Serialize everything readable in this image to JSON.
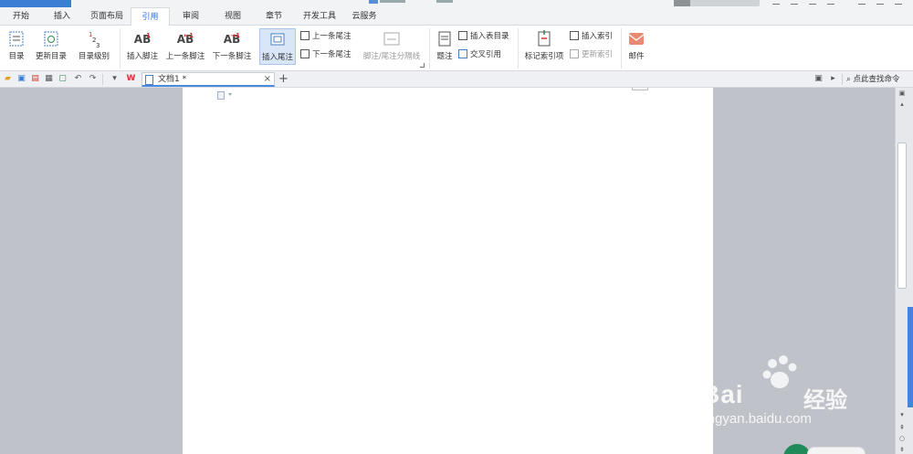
{
  "tabs": [
    "开始",
    "插入",
    "页面布局",
    "引用",
    "审阅",
    "视图",
    "章节",
    "开发工具",
    "云服务"
  ],
  "active_tab": "引用",
  "ribbon": {
    "toc": "目录",
    "update_toc": "更新目录",
    "toc_level": "目录级别",
    "insert_footnote": "插入脚注",
    "prev_footnote": "上一条脚注",
    "next_footnote": "下一条脚注",
    "insert_endnote": "插入尾注",
    "prev_endnote": "上一条尾注",
    "next_endnote": "下一条尾注",
    "separator_line": "脚注/尾注分隔线",
    "caption": "题注",
    "insert_table_of_figures": "插入表目录",
    "cross_reference": "交叉引用",
    "mark_entry": "标记索引项",
    "insert_index": "插入索引",
    "update_index": "更新索引",
    "mail": "邮件"
  },
  "doc_tab": {
    "title": "文档1 *",
    "close": "×",
    "new_tab": "+"
  },
  "find_command": "点此查找命令",
  "watermark": {
    "brand": "Bai",
    "brand_cn": "经验",
    "url": "jingyan.baidu.com"
  },
  "colors": {
    "accent": "#2b6fd6",
    "workspace": "#bfc2c8",
    "sidebar_accent": "#3f86dd"
  }
}
